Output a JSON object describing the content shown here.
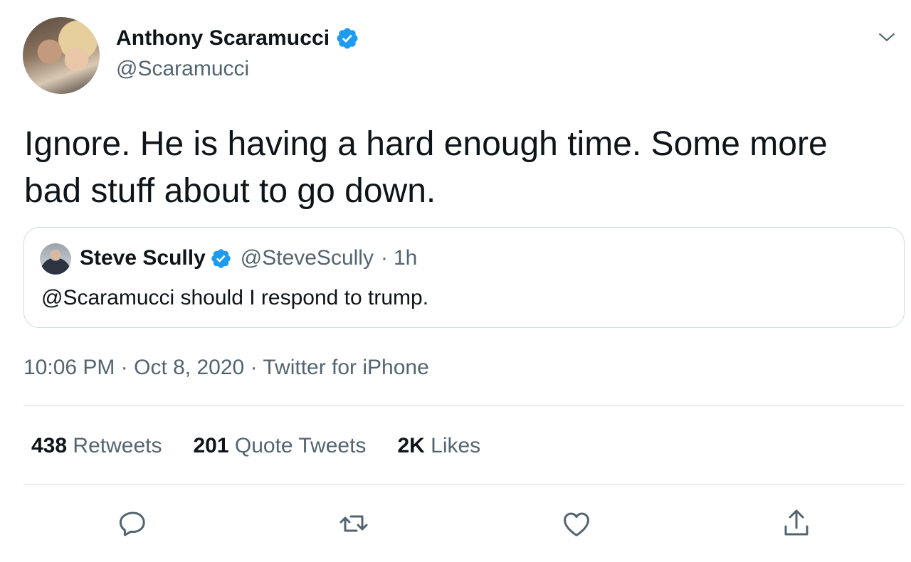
{
  "tweet": {
    "author": {
      "name": "Anthony Scaramucci",
      "handle": "@Scaramucci",
      "verified": true
    },
    "text": "Ignore. He is having a hard enough time. Some more bad stuff about to go down.",
    "quoted": {
      "name": "Steve Scully",
      "handle": "@SteveScully",
      "separator": "·",
      "age": "1h",
      "text": "@Scaramucci should I respond to trump.",
      "verified": true
    },
    "meta": {
      "time": "10:06 PM",
      "date": "Oct 8, 2020",
      "source": "Twitter for iPhone",
      "separator": "·"
    },
    "stats": {
      "retweets": {
        "count": "438",
        "label": "Retweets"
      },
      "quotes": {
        "count": "201",
        "label": "Quote Tweets"
      },
      "likes": {
        "count": "2K",
        "label": "Likes"
      }
    },
    "actions": [
      "reply-icon",
      "retweet-icon",
      "like-icon",
      "share-icon"
    ]
  },
  "colors": {
    "text_primary": "#0f1419",
    "text_secondary": "#536471",
    "verified_blue": "#1d9bf0",
    "border": "#cfd9de"
  }
}
